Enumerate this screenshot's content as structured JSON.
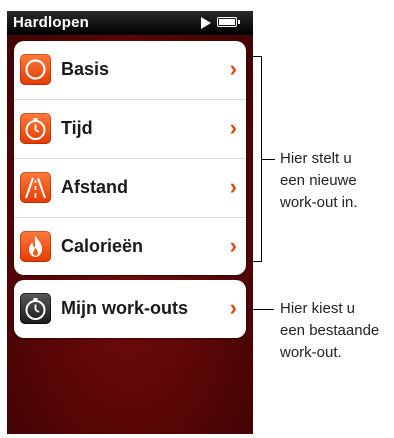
{
  "status_bar": {
    "title": "Hardlopen"
  },
  "menu": {
    "items": [
      {
        "label": "Basis",
        "icon": "circle-icon"
      },
      {
        "label": "Tijd",
        "icon": "stopwatch-icon"
      },
      {
        "label": "Afstand",
        "icon": "road-icon"
      },
      {
        "label": "Calorieën",
        "icon": "flame-icon"
      }
    ]
  },
  "workouts": {
    "label": "Mijn work-outs",
    "icon": "stopwatch-icon"
  },
  "chevron_glyph": "›",
  "callouts": {
    "new_workout": "Hier stelt u\neen nieuwe\nwork-out in.",
    "existing_workout": "Hier kiest u\neen bestaande\nwork-out."
  },
  "colors": {
    "accent": "#e0480e",
    "background_dark": "#5a0606",
    "status_bar": "#000000"
  }
}
